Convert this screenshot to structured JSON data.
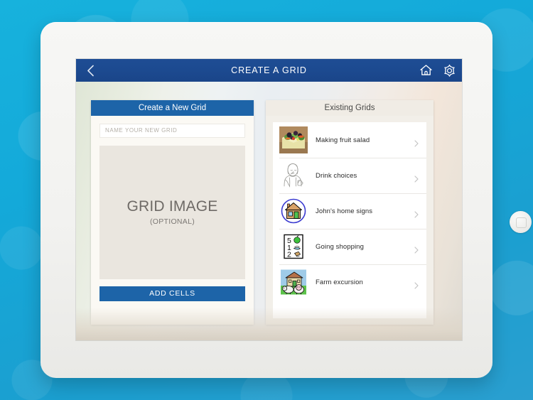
{
  "device": {
    "camera": "front-camera-dot",
    "home_button": "home-button"
  },
  "app": {
    "navbar": {
      "title": "CREATE A GRID",
      "back_icon": "chevron-left-icon",
      "home_icon": "home-icon",
      "settings_icon": "gear-icon",
      "bg_color": "#1c4a90"
    },
    "left_panel": {
      "header": "Create a New Grid",
      "name_field": {
        "value": "",
        "placeholder": "NAME YOUR NEW GRID"
      },
      "image_placeholder": {
        "title": "GRID IMAGE",
        "subtitle": "(OPTIONAL)"
      },
      "add_cells_label": "ADD CELLS",
      "accent_color": "#1d64a8"
    },
    "right_panel": {
      "header": "Existing Grids",
      "chevron_icon": "chevron-right-icon",
      "items": [
        {
          "label": "Making fruit salad",
          "icon": "fruit-salad-photo-icon"
        },
        {
          "label": "Drink choices",
          "icon": "person-drinking-line-icon"
        },
        {
          "label": "John's home signs",
          "icon": "house-in-circle-icon"
        },
        {
          "label": "Going shopping",
          "icon": "shopping-list-icon"
        },
        {
          "label": "Farm excursion",
          "icon": "farm-sheep-icon"
        }
      ],
      "shopping_list_numbers": [
        "5",
        "1",
        "2"
      ]
    }
  }
}
